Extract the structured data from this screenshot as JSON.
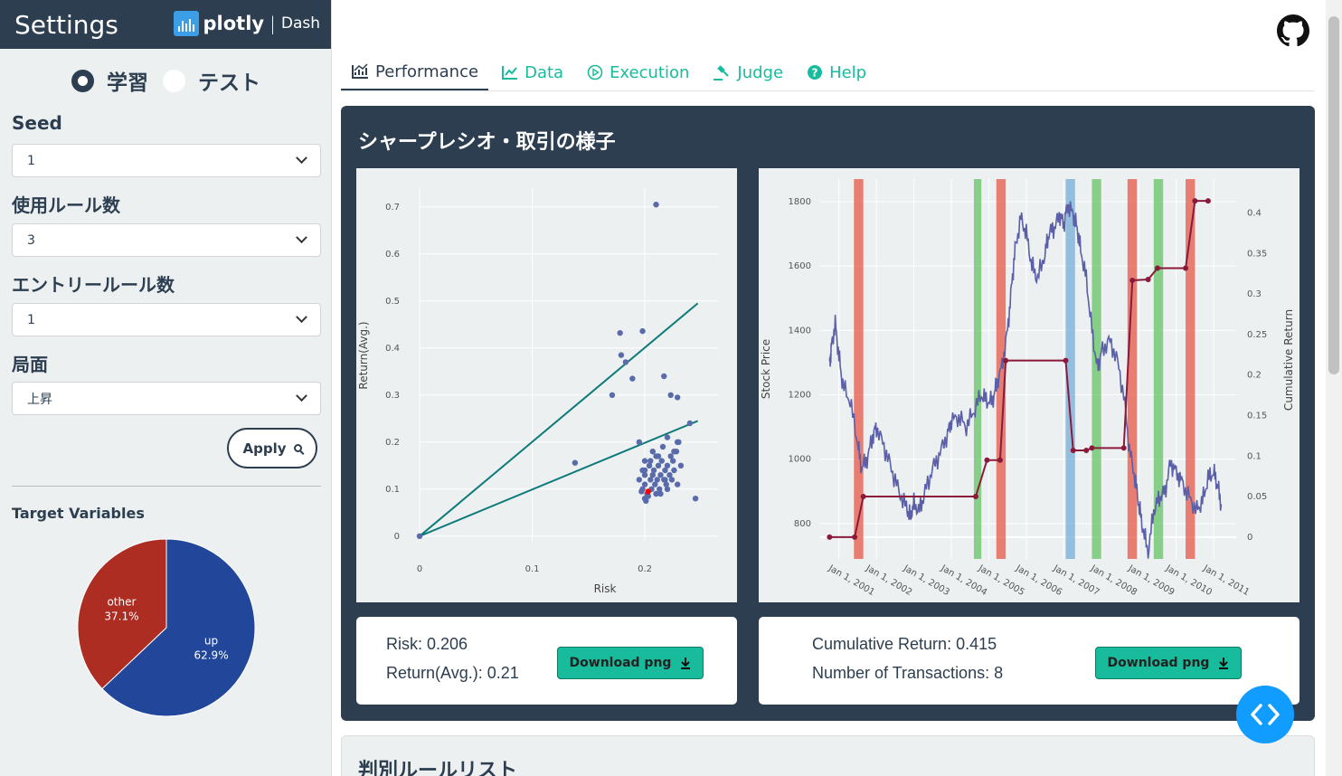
{
  "sidebar": {
    "title": "Settings",
    "brand_word": "plotly",
    "brand_sep": "|",
    "brand_dash": "Dash",
    "mode_options": [
      "学習",
      "テスト"
    ],
    "mode_selected": "学習",
    "fields": [
      {
        "label": "Seed",
        "value": "1"
      },
      {
        "label": "使用ルール数",
        "value": "3"
      },
      {
        "label": "エントリールール数",
        "value": "1"
      },
      {
        "label": "局面",
        "value": "上昇"
      }
    ],
    "apply_label": "Apply",
    "target_label": "Target Variables",
    "pie": {
      "type": "pie",
      "slices": [
        {
          "label": "up",
          "value": 62.9,
          "text": "62.9%",
          "color": "#22479a"
        },
        {
          "label": "other",
          "value": 37.1,
          "text": "37.1%",
          "color": "#ad2d23"
        }
      ]
    }
  },
  "tabs": [
    {
      "label": "Performance",
      "icon": "chart-line-icon",
      "active": true
    },
    {
      "label": "Data",
      "icon": "area-chart-icon",
      "active": false
    },
    {
      "label": "Execution",
      "icon": "play-circle-icon",
      "active": false
    },
    {
      "label": "Judge",
      "icon": "gavel-icon",
      "active": false
    },
    {
      "label": "Help",
      "icon": "question-circle-icon",
      "active": false
    }
  ],
  "card": {
    "title": "シャープレシオ・取引の様子",
    "left_info": {
      "risk": "Risk: 0.206",
      "return": "Return(Avg.): 0.21"
    },
    "right_info": {
      "cum_return": "Cumulative Return: 0.415",
      "transactions": "Number of Transactions: 8"
    },
    "download_label": "Download png"
  },
  "rule_card": {
    "title": "判別ルールリスト"
  },
  "fab_label": "< >",
  "chart_data": [
    {
      "type": "scatter",
      "xlabel": "Risk",
      "ylabel": "Return(Avg.)",
      "xlim": [
        0,
        0.265
      ],
      "ylim": [
        -0.01,
        0.74
      ],
      "x_ticks": [
        "0",
        "0.1",
        "0.2"
      ],
      "x_tick_values": [
        0,
        0.1,
        0.2
      ],
      "y_ticks": [
        "0",
        "0.1",
        "0.2",
        "0.3",
        "0.4",
        "0.5",
        "0.6",
        "0.7"
      ],
      "y_tick_values": [
        0,
        0.1,
        0.2,
        0.3,
        0.4,
        0.5,
        0.6,
        0.7
      ],
      "lines": [
        {
          "x": [
            0,
            0.247
          ],
          "y": [
            0,
            0.495
          ],
          "color": "#0e7a7a"
        },
        {
          "x": [
            0,
            0.247
          ],
          "y": [
            0,
            0.245
          ],
          "color": "#0e7a7a"
        }
      ],
      "points": [
        [
          0,
          0
        ],
        [
          0.138,
          0.156
        ],
        [
          0.171,
          0.3
        ],
        [
          0.178,
          0.432
        ],
        [
          0.179,
          0.385
        ],
        [
          0.183,
          0.37
        ],
        [
          0.189,
          0.335
        ],
        [
          0.198,
          0.436
        ],
        [
          0.21,
          0.705
        ],
        [
          0.217,
          0.34
        ],
        [
          0.223,
          0.3
        ],
        [
          0.229,
          0.295
        ],
        [
          0.24,
          0.24
        ],
        [
          0.245,
          0.08
        ],
        [
          0.195,
          0.2
        ],
        [
          0.2,
          0.16
        ],
        [
          0.2,
          0.13
        ],
        [
          0.195,
          0.12
        ],
        [
          0.198,
          0.14
        ],
        [
          0.2,
          0.11
        ],
        [
          0.202,
          0.09
        ],
        [
          0.204,
          0.15
        ],
        [
          0.205,
          0.12
        ],
        [
          0.206,
          0.1
        ],
        [
          0.207,
          0.13
        ],
        [
          0.208,
          0.14
        ],
        [
          0.209,
          0.11
        ],
        [
          0.21,
          0.17
        ],
        [
          0.211,
          0.12
        ],
        [
          0.212,
          0.15
        ],
        [
          0.213,
          0.1
        ],
        [
          0.214,
          0.13
        ],
        [
          0.215,
          0.16
        ],
        [
          0.216,
          0.19
        ],
        [
          0.217,
          0.12
        ],
        [
          0.218,
          0.14
        ],
        [
          0.219,
          0.11
        ],
        [
          0.22,
          0.15
        ],
        [
          0.222,
          0.13
        ],
        [
          0.223,
          0.17
        ],
        [
          0.224,
          0.12
        ],
        [
          0.225,
          0.16
        ],
        [
          0.226,
          0.14
        ],
        [
          0.228,
          0.18
        ],
        [
          0.229,
          0.11
        ],
        [
          0.23,
          0.2
        ],
        [
          0.232,
          0.15
        ],
        [
          0.198,
          0.1
        ],
        [
          0.2,
          0.08
        ],
        [
          0.201,
          0.075
        ],
        [
          0.203,
          0.085
        ],
        [
          0.197,
          0.095
        ],
        [
          0.214,
          0.09
        ],
        [
          0.22,
          0.1
        ],
        [
          0.212,
          0.17
        ],
        [
          0.207,
          0.18
        ],
        [
          0.218,
          0.12
        ],
        [
          0.21,
          0.09
        ],
        [
          0.2,
          0.14
        ],
        [
          0.205,
          0.16
        ],
        [
          0.226,
          0.18
        ],
        [
          0.229,
          0.2
        ],
        [
          0.22,
          0.21
        ]
      ],
      "highlight_point": [
        0.203,
        0.095
      ],
      "point_color": "#5a6bab",
      "highlight_color": "#ff0000"
    },
    {
      "type": "line",
      "ylabel": "Stock Price",
      "y2label": "Cumulative Return",
      "x_ticks": [
        "Jan 1, 2001",
        "Jan 1, 2002",
        "Jan 1, 2003",
        "Jan 1, 2004",
        "Jan 1, 2005",
        "Jan 1, 2006",
        "Jan 1, 2007",
        "Jan 1, 2008",
        "Jan 1, 2009",
        "Jan 1, 2010",
        "Jan 1, 2011"
      ],
      "xlim": [
        2000.5,
        2011.6
      ],
      "ylim": [
        690,
        1870
      ],
      "y_ticks": [
        "800",
        "1000",
        "1200",
        "1400",
        "1600",
        "1800"
      ],
      "y_tick_values": [
        800,
        1000,
        1200,
        1400,
        1600,
        1800
      ],
      "y2lim": [
        -0.027,
        0.442
      ],
      "y2_ticks": [
        "0",
        "0.05",
        "0.1",
        "0.15",
        "0.2",
        "0.25",
        "0.3",
        "0.35",
        "0.4"
      ],
      "y2_tick_values": [
        0,
        0.05,
        0.1,
        0.15,
        0.2,
        0.25,
        0.3,
        0.35,
        0.4
      ],
      "price_series": [
        [
          2000.75,
          1290
        ],
        [
          2000.8,
          1350
        ],
        [
          2000.9,
          1420
        ],
        [
          2001.0,
          1320
        ],
        [
          2001.1,
          1230
        ],
        [
          2001.3,
          1180
        ],
        [
          2001.5,
          1050
        ],
        [
          2001.6,
          970
        ],
        [
          2001.75,
          1000
        ],
        [
          2001.9,
          1070
        ],
        [
          2002.0,
          1100
        ],
        [
          2002.2,
          1040
        ],
        [
          2002.4,
          970
        ],
        [
          2002.6,
          900
        ],
        [
          2002.8,
          850
        ],
        [
          2002.9,
          820
        ],
        [
          2003.0,
          860
        ],
        [
          2003.15,
          840
        ],
        [
          2003.3,
          900
        ],
        [
          2003.5,
          970
        ],
        [
          2003.7,
          1020
        ],
        [
          2003.9,
          1080
        ],
        [
          2004.0,
          1120
        ],
        [
          2004.2,
          1130
        ],
        [
          2004.4,
          1100
        ],
        [
          2004.6,
          1150
        ],
        [
          2004.8,
          1200
        ],
        [
          2004.95,
          1180
        ],
        [
          2005.1,
          1180
        ],
        [
          2005.2,
          1230
        ],
        [
          2005.35,
          1290
        ],
        [
          2005.5,
          1400
        ],
        [
          2005.6,
          1530
        ],
        [
          2005.7,
          1650
        ],
        [
          2005.85,
          1750
        ],
        [
          2006.0,
          1700
        ],
        [
          2006.15,
          1600
        ],
        [
          2006.3,
          1560
        ],
        [
          2006.5,
          1640
        ],
        [
          2006.6,
          1700
        ],
        [
          2006.75,
          1720
        ],
        [
          2006.9,
          1760
        ],
        [
          2007.0,
          1730
        ],
        [
          2007.1,
          1790
        ],
        [
          2007.25,
          1760
        ],
        [
          2007.35,
          1720
        ],
        [
          2007.45,
          1650
        ],
        [
          2007.6,
          1560
        ],
        [
          2007.75,
          1400
        ],
        [
          2007.9,
          1280
        ],
        [
          2008.0,
          1330
        ],
        [
          2008.2,
          1370
        ],
        [
          2008.4,
          1320
        ],
        [
          2008.6,
          1200
        ],
        [
          2008.75,
          1030
        ],
        [
          2008.9,
          940
        ],
        [
          2009.0,
          860
        ],
        [
          2009.1,
          790
        ],
        [
          2009.25,
          710
        ],
        [
          2009.4,
          840
        ],
        [
          2009.55,
          880
        ],
        [
          2009.7,
          900
        ],
        [
          2009.85,
          990
        ],
        [
          2010.0,
          960
        ],
        [
          2010.15,
          930
        ],
        [
          2010.35,
          880
        ],
        [
          2010.55,
          840
        ],
        [
          2010.7,
          870
        ],
        [
          2010.85,
          940
        ],
        [
          2011.0,
          960
        ],
        [
          2011.1,
          920
        ],
        [
          2011.2,
          860
        ]
      ],
      "cum_return_series": [
        [
          2000.75,
          0
        ],
        [
          2001.42,
          0
        ],
        [
          2001.65,
          0.05
        ],
        [
          2004.65,
          0.05
        ],
        [
          2004.95,
          0.095
        ],
        [
          2005.3,
          0.095
        ],
        [
          2005.45,
          0.218
        ],
        [
          2007.05,
          0.218
        ],
        [
          2007.25,
          0.107
        ],
        [
          2007.6,
          0.107
        ],
        [
          2007.75,
          0.11
        ],
        [
          2008.6,
          0.11
        ],
        [
          2008.83,
          0.317
        ],
        [
          2009.25,
          0.318
        ],
        [
          2009.5,
          0.332
        ],
        [
          2010.25,
          0.332
        ],
        [
          2010.5,
          0.415
        ],
        [
          2010.85,
          0.415
        ]
      ],
      "price_color": "#5a5fa8",
      "return_color": "#8b1a3a",
      "bands": [
        {
          "from": 2001.4,
          "to": 2001.65,
          "color": "#e74c3c"
        },
        {
          "from": 2004.6,
          "to": 2004.8,
          "color": "#5cbf5c"
        },
        {
          "from": 2005.2,
          "to": 2005.45,
          "color": "#e74c3c"
        },
        {
          "from": 2007.05,
          "to": 2007.3,
          "color": "#6fa8d6"
        },
        {
          "from": 2007.75,
          "to": 2008.0,
          "color": "#5cbf5c"
        },
        {
          "from": 2008.7,
          "to": 2008.95,
          "color": "#e74c3c"
        },
        {
          "from": 2009.4,
          "to": 2009.65,
          "color": "#5cbf5c"
        },
        {
          "from": 2010.25,
          "to": 2010.5,
          "color": "#e74c3c"
        }
      ]
    }
  ]
}
